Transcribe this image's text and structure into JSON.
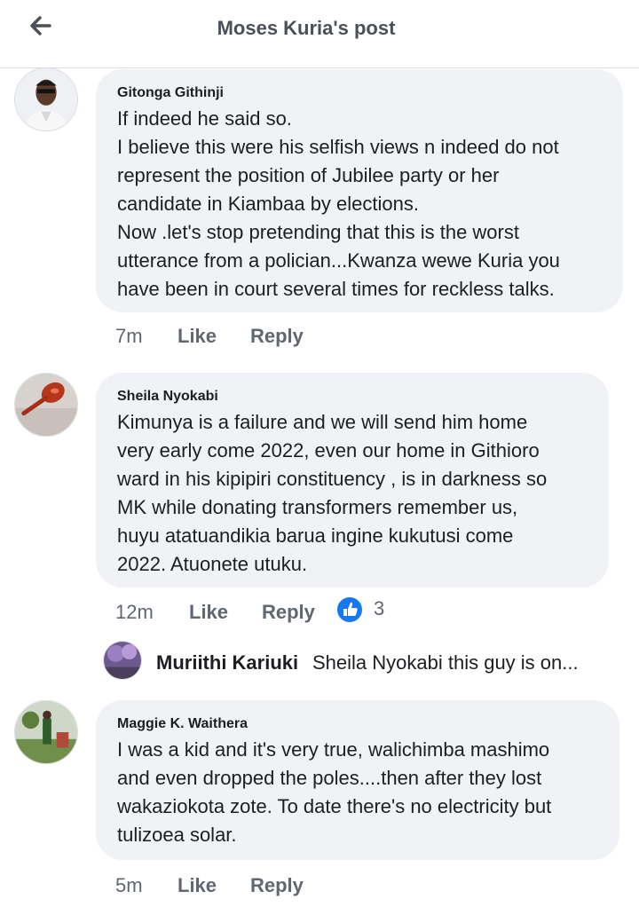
{
  "header": {
    "title": "Moses Kuria's post",
    "back_icon": "arrow-left-icon"
  },
  "colors": {
    "bubble": "#f0f2f5",
    "meta_text": "#606770",
    "like_blue": "#1877f2"
  },
  "comments": [
    {
      "author": "Gitonga Githinji",
      "lines": [
        "If indeed he said so.",
        "I believe this were his selfish views n indeed do not",
        "represent the position of Jubilee party or her",
        "candidate in Kiambaa by elections.",
        "Now .let's stop pretending that this is the worst",
        "utterance from a polician...Kwanza wewe Kuria you",
        "have been in court several times for reckless talks."
      ],
      "time": "7m",
      "like": "Like",
      "reply": "Reply"
    },
    {
      "author": "Sheila Nyokabi",
      "lines": [
        "Kimunya is a failure and we will send him home",
        "very early come 2022, even our home in Githioro",
        "ward in his kipipiri constituency , is in darkness so",
        "MK while donating transformers remember us,",
        "huyu atatuandikia barua ingine kukutusi come",
        "2022. Atuonete utuku."
      ],
      "time": "12m",
      "like": "Like",
      "reply": "Reply",
      "reaction_count": "3"
    },
    {
      "author": "Maggie K. Waithera",
      "lines": [
        "I was a kid and it's very true, walichimba mashimo",
        "and even dropped the poles....then after they lost",
        "wakaziokota zote. To date there's no electricity but",
        "tulizoea solar."
      ],
      "time": "5m",
      "like": "Like",
      "reply": "Reply"
    }
  ],
  "reply_preview": {
    "name": "Muriithi Kariuki",
    "snippet": "Sheila Nyokabi this guy is on..."
  }
}
